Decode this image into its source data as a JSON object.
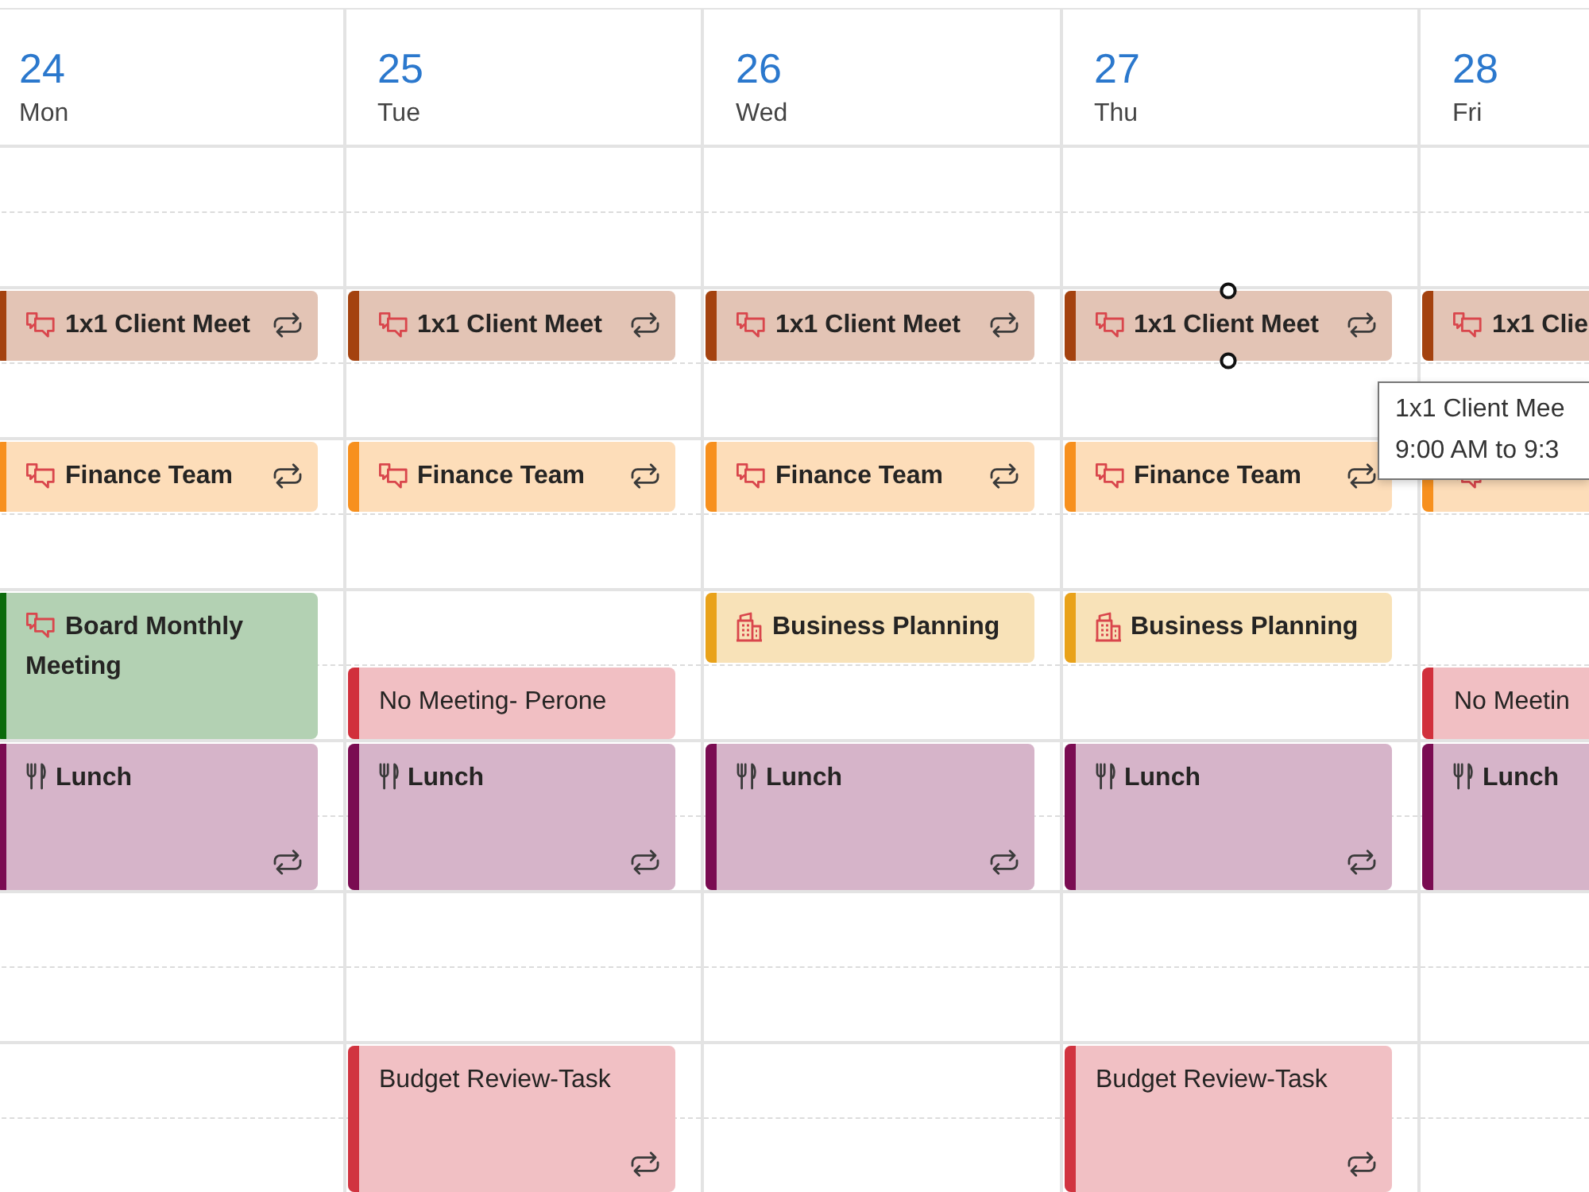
{
  "days": [
    {
      "number": "24",
      "weekday": "Mon",
      "slots": [
        {
          "kind": "empty"
        },
        {
          "kind": "empty"
        },
        {
          "kind": "meeting",
          "title": "1x1 Client Meet",
          "long": false,
          "recurring": true,
          "selected": false,
          "color": "#a4420f"
        },
        {
          "kind": "empty"
        },
        {
          "kind": "meeting",
          "title": "Finance Team",
          "long": false,
          "recurring": true,
          "selected": false,
          "color": "#f7901e"
        },
        {
          "kind": "empty"
        },
        {
          "kind": "meeting",
          "title": "Board Monthly Meeting",
          "long": true,
          "recurring": false,
          "selected": false,
          "color": "#0b6a0b"
        },
        {
          "kind": "meal",
          "title": "Lunch",
          "long": true,
          "recurring": true,
          "selected": false,
          "color": "#7a0c52"
        },
        {
          "kind": "empty"
        },
        {
          "kind": "empty"
        },
        {
          "kind": "empty"
        },
        {
          "kind": "empty"
        }
      ]
    },
    {
      "number": "25",
      "weekday": "Tue",
      "slots": [
        {
          "kind": "empty"
        },
        {
          "kind": "empty"
        },
        {
          "kind": "meeting",
          "title": "1x1 Client Meet",
          "long": false,
          "recurring": true,
          "selected": false,
          "color": "#a4420f"
        },
        {
          "kind": "empty"
        },
        {
          "kind": "meeting",
          "title": "Finance Team",
          "long": false,
          "recurring": true,
          "selected": false,
          "color": "#f7901e"
        },
        {
          "kind": "empty"
        },
        {
          "kind": "empty"
        },
        {
          "kind": "plain",
          "title": "No Meeting- Perone",
          "long": false,
          "recurring": false,
          "selected": false,
          "color": "#d1303c"
        },
        {
          "kind": "meal",
          "title": "Lunch",
          "long": true,
          "recurring": true,
          "selected": false,
          "color": "#7a0c52"
        },
        {
          "kind": "empty"
        },
        {
          "kind": "empty"
        },
        {
          "kind": "plain",
          "title": "Budget Review-Task",
          "long": true,
          "recurring": true,
          "selected": false,
          "color": "#d13440"
        }
      ]
    },
    {
      "number": "26",
      "weekday": "Wed",
      "slots": [
        {
          "kind": "empty"
        },
        {
          "kind": "empty"
        },
        {
          "kind": "meeting",
          "title": "1x1 Client Meet",
          "long": false,
          "recurring": true,
          "selected": false,
          "color": "#a4420f"
        },
        {
          "kind": "empty"
        },
        {
          "kind": "meeting",
          "title": "Finance Team",
          "long": false,
          "recurring": true,
          "selected": false,
          "color": "#f7901e"
        },
        {
          "kind": "empty"
        },
        {
          "kind": "planning",
          "title": "Business Planning",
          "long": false,
          "recurring": false,
          "selected": false,
          "color": "#e9a21a"
        },
        {
          "kind": "empty"
        },
        {
          "kind": "meal",
          "title": "Lunch",
          "long": true,
          "recurring": true,
          "selected": false,
          "color": "#7a0c52"
        },
        {
          "kind": "empty"
        },
        {
          "kind": "empty"
        },
        {
          "kind": "empty"
        },
        {
          "kind": "empty"
        }
      ]
    },
    {
      "number": "27",
      "weekday": "Thu",
      "slots": [
        {
          "kind": "empty"
        },
        {
          "kind": "empty"
        },
        {
          "kind": "meeting",
          "title": "1x1 Client Meet",
          "long": false,
          "recurring": true,
          "selected": true,
          "color": "#a4420f"
        },
        {
          "kind": "empty"
        },
        {
          "kind": "meeting",
          "title": "Finance Team",
          "long": false,
          "recurring": true,
          "selected": false,
          "color": "#f7901e"
        },
        {
          "kind": "empty"
        },
        {
          "kind": "planning",
          "title": "Business Planning",
          "long": false,
          "recurring": false,
          "selected": false,
          "color": "#e9a21a"
        },
        {
          "kind": "empty"
        },
        {
          "kind": "meal",
          "title": "Lunch",
          "long": true,
          "recurring": true,
          "selected": false,
          "color": "#7a0c52"
        },
        {
          "kind": "empty"
        },
        {
          "kind": "empty"
        },
        {
          "kind": "plain",
          "title": "Budget Review-Task",
          "long": true,
          "recurring": true,
          "selected": false,
          "color": "#d13440"
        }
      ]
    },
    {
      "number": "28",
      "weekday": "Fri",
      "slots": [
        {
          "kind": "empty"
        },
        {
          "kind": "empty"
        },
        {
          "kind": "meeting",
          "title": "1x1 Clie",
          "long": false,
          "recurring": false,
          "selected": false,
          "color": "#a4420f"
        },
        {
          "kind": "empty"
        },
        {
          "kind": "meeting",
          "long": false,
          "recurring": false,
          "selected": false,
          "color": "#f7901e"
        },
        {
          "kind": "empty"
        },
        {
          "kind": "empty"
        },
        {
          "kind": "plain",
          "title": "No Meetin",
          "long": false,
          "recurring": false,
          "selected": false,
          "color": "#d1303c"
        },
        {
          "kind": "meal",
          "title": "Lunch",
          "long": true,
          "recurring": false,
          "selected": false,
          "color": "#7a0c52"
        },
        {
          "kind": "empty"
        },
        {
          "kind": "empty"
        },
        {
          "kind": "empty"
        },
        {
          "kind": "empty"
        }
      ]
    }
  ],
  "tooltip": {
    "title": "1x1 Client Mee",
    "time": "9:00 AM to 9:3"
  }
}
